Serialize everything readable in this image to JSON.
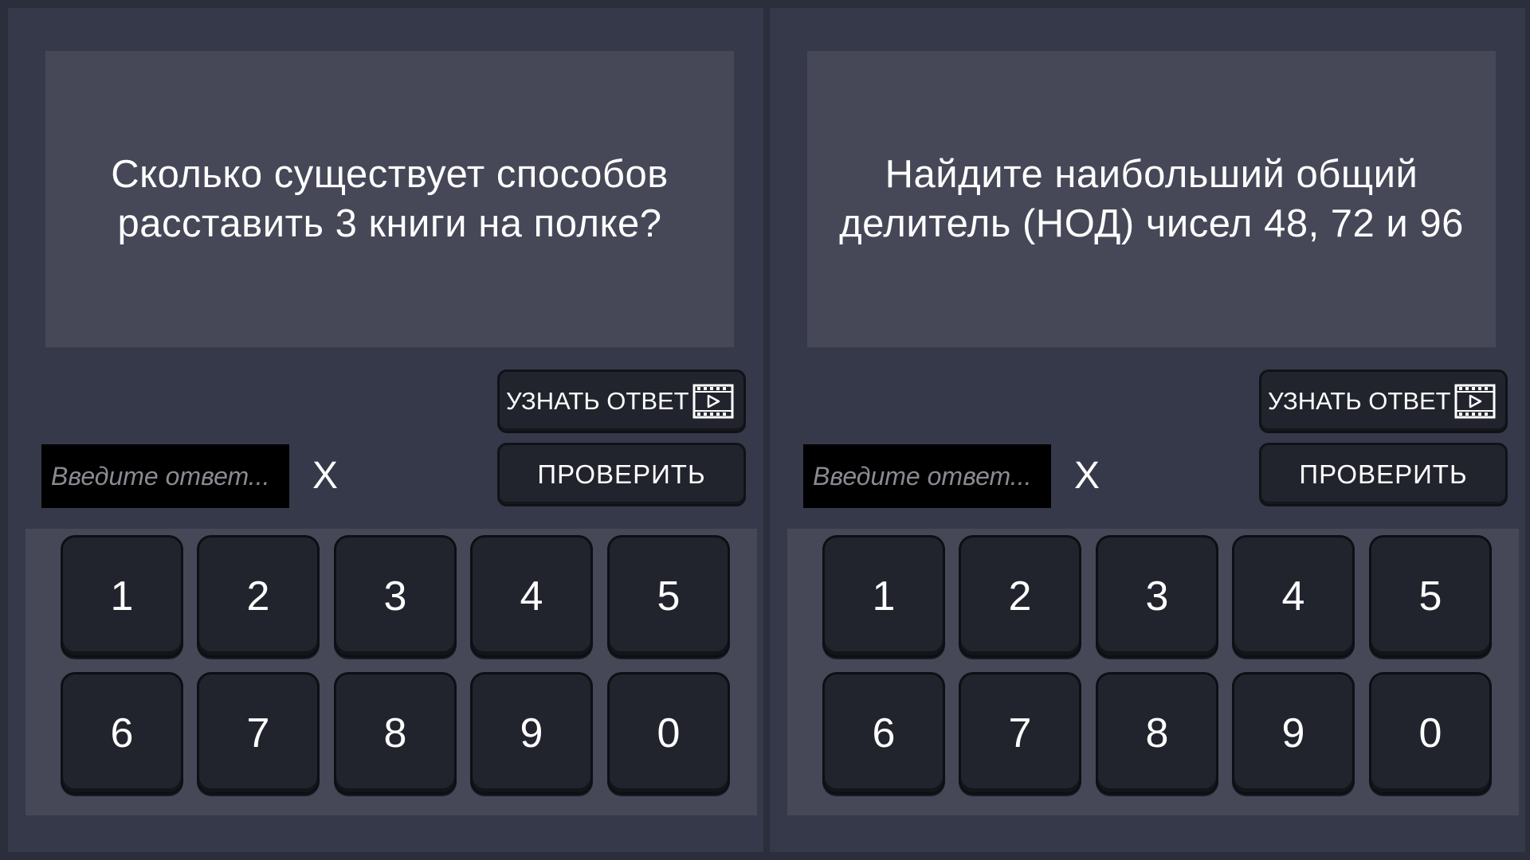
{
  "panels": [
    {
      "question": "Сколько существует способов расставить 3 книги на полке?",
      "reveal_label": "УЗНАТЬ ОТВЕТ",
      "reveal_icon": "video-play-icon",
      "check_label": "ПРОВЕРИТЬ",
      "input_placeholder": "Введите ответ...",
      "input_value": "",
      "clear_label": "X",
      "keys": [
        "1",
        "2",
        "3",
        "4",
        "5",
        "6",
        "7",
        "8",
        "9",
        "0"
      ]
    },
    {
      "question": "Найдите наибольший общий делитель (НОД) чисел 48, 72 и 96",
      "reveal_label": "УЗНАТЬ ОТВЕТ",
      "reveal_icon": "video-play-icon",
      "check_label": "ПРОВЕРИТЬ",
      "input_placeholder": "Введите ответ...",
      "input_value": "",
      "clear_label": "X",
      "keys": [
        "1",
        "2",
        "3",
        "4",
        "5",
        "6",
        "7",
        "8",
        "9",
        "0"
      ]
    }
  ],
  "colors": {
    "background": "#2b2e3b",
    "panel": "#363949",
    "question_box": "#464858",
    "button": "#22242d",
    "text": "#ffffff"
  }
}
